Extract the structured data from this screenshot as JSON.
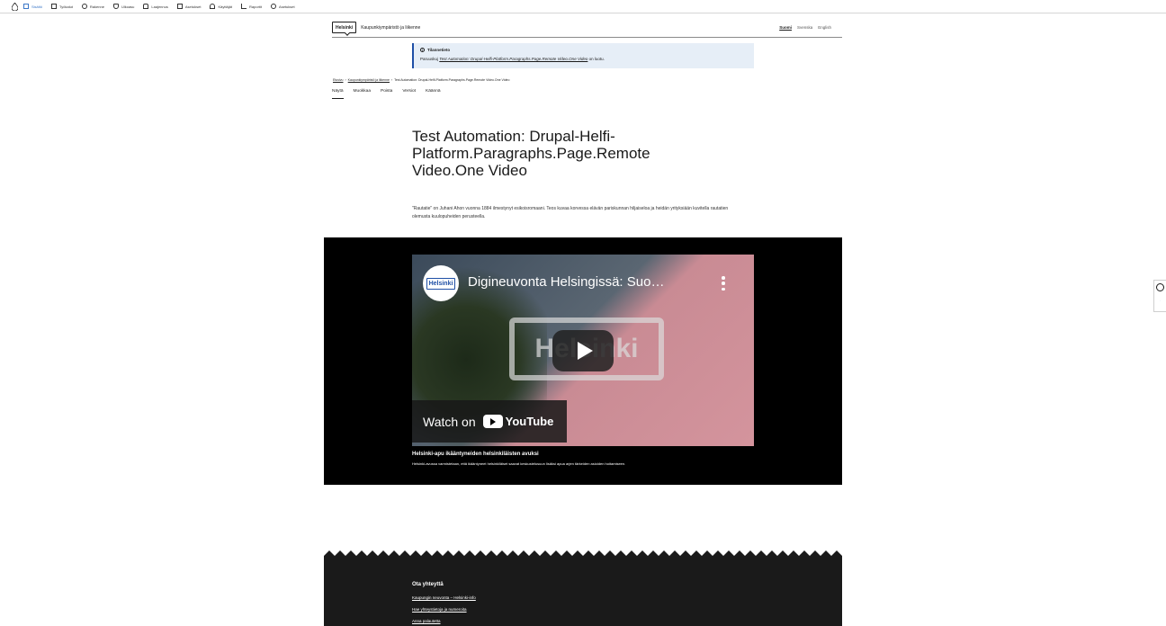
{
  "toolbar": {
    "items": [
      {
        "label": "Sisältö",
        "icon": "content-icon",
        "active": true
      },
      {
        "label": "Työkalut",
        "icon": "tools-icon"
      },
      {
        "label": "Rakenne",
        "icon": "structure-icon"
      },
      {
        "label": "Ulkoasu",
        "icon": "appearance-icon"
      },
      {
        "label": "Laajennus",
        "icon": "extend-icon"
      },
      {
        "label": "Asetukset",
        "icon": "config-icon"
      },
      {
        "label": "Käyttäjät",
        "icon": "people-icon"
      },
      {
        "label": "Raportit",
        "icon": "reports-icon"
      },
      {
        "label": "Asetukset",
        "icon": "help-icon"
      }
    ]
  },
  "header": {
    "logo": "Helsinki",
    "site_name": "Kaupunkiympäristö ja liikenne",
    "langs": [
      "Suomi",
      "Svenska",
      "English"
    ]
  },
  "notice": {
    "title": "Tilannetieto",
    "prefix": "Paruuskuj",
    "link": "Test Automation: Drupal-Helfi-Platform.Paragraphs.Page.Remote Video.One Video",
    "suffix": "on luotu."
  },
  "breadcrumb": {
    "items": [
      "Etusivu",
      "Kaupunkiympäristö ja liikenne",
      "Test Automation: Drupal-Helfi-Platform.Paragraphs.Page.Remote Video.One Video"
    ]
  },
  "tabs": [
    "Näytä",
    "Muokkaa",
    "Poista",
    "Versiot",
    "Käännä"
  ],
  "page": {
    "title": "Test Automation: Drupal-Helfi-Platform.Paragraphs.Page.Remote Video.One Video",
    "lead": "\"Rautatie\" on Juhani Ahon vuonna 1884 ilmestynyt esikoisromaani. Teos kuvaa korvessa elävän pariskunnan hiljaiseloa ja heidän yrityksiään kuvitella rautatien olemusta kuulopuheiden perusteella."
  },
  "video": {
    "channel": "Helsinki",
    "title": "Digineuvonta Helsingissä: Suo…",
    "watch_on": "Watch on",
    "youtube": "YouTube",
    "caption_title": "Helsinki-apu ikääntyneiden helsinkiläisten avuksi",
    "caption_desc": "Helsinki-avussa varmistetaan, että ikääntyneet helsinkiläiset saavat keskustelusuun lisäksi apua arjen tärkeiden asioiden hoitamiseen."
  },
  "footer": {
    "heading": "Ota yhteyttä",
    "links": [
      "Kaupungin neuvonta – Helsinki-info",
      "Hae yhteystietoja ja numeroita",
      "Anna palautetta"
    ]
  },
  "colors": {
    "accent": "#3d78c8",
    "notice_bg": "#e6eef7",
    "notice_border": "#1f4fa6",
    "footer_bg": "#1a1a1a"
  }
}
